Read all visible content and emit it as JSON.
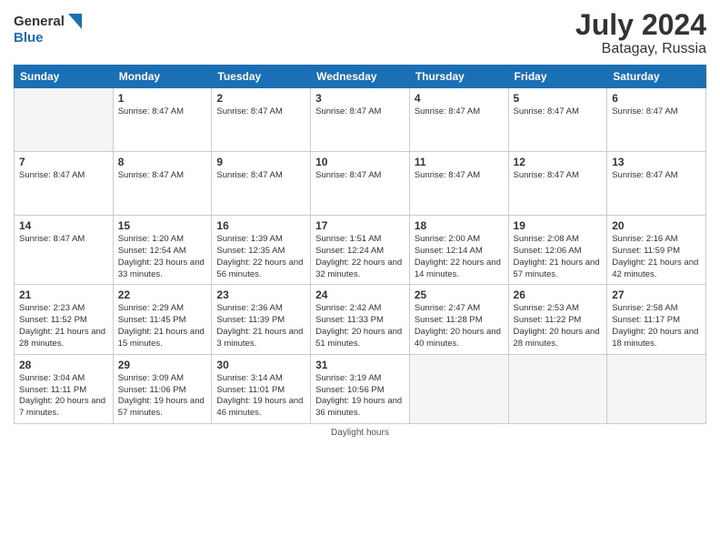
{
  "logo": {
    "line1": "General",
    "line2": "Blue"
  },
  "title": "July 2024",
  "location": "Batagay, Russia",
  "days_of_week": [
    "Sunday",
    "Monday",
    "Tuesday",
    "Wednesday",
    "Thursday",
    "Friday",
    "Saturday"
  ],
  "footer": "Daylight hours",
  "weeks": [
    [
      {
        "day": "",
        "info": ""
      },
      {
        "day": "1",
        "info": "Sunrise: 8:47 AM"
      },
      {
        "day": "2",
        "info": "Sunrise: 8:47 AM"
      },
      {
        "day": "3",
        "info": "Sunrise: 8:47 AM"
      },
      {
        "day": "4",
        "info": "Sunrise: 8:47 AM"
      },
      {
        "day": "5",
        "info": "Sunrise: 8:47 AM"
      },
      {
        "day": "6",
        "info": "Sunrise: 8:47 AM"
      }
    ],
    [
      {
        "day": "7",
        "info": "Sunrise: 8:47 AM"
      },
      {
        "day": "8",
        "info": "Sunrise: 8:47 AM"
      },
      {
        "day": "9",
        "info": "Sunrise: 8:47 AM"
      },
      {
        "day": "10",
        "info": "Sunrise: 8:47 AM"
      },
      {
        "day": "11",
        "info": "Sunrise: 8:47 AM"
      },
      {
        "day": "12",
        "info": "Sunrise: 8:47 AM"
      },
      {
        "day": "13",
        "info": "Sunrise: 8:47 AM"
      }
    ],
    [
      {
        "day": "14",
        "info": "Sunrise: 8:47 AM"
      },
      {
        "day": "15",
        "info": "Sunrise: 1:20 AM\nSunset: 12:54 AM\nDaylight: 23 hours and 33 minutes."
      },
      {
        "day": "16",
        "info": "Sunrise: 1:39 AM\nSunset: 12:35 AM\nDaylight: 22 hours and 56 minutes."
      },
      {
        "day": "17",
        "info": "Sunrise: 1:51 AM\nSunset: 12:24 AM\nDaylight: 22 hours and 32 minutes."
      },
      {
        "day": "18",
        "info": "Sunrise: 2:00 AM\nSunset: 12:14 AM\nDaylight: 22 hours and 14 minutes."
      },
      {
        "day": "19",
        "info": "Sunrise: 2:08 AM\nSunset: 12:06 AM\nDaylight: 21 hours and 57 minutes."
      },
      {
        "day": "20",
        "info": "Sunrise: 2:16 AM\nSunset: 11:59 PM\nDaylight: 21 hours and 42 minutes."
      }
    ],
    [
      {
        "day": "21",
        "info": "Sunrise: 2:23 AM\nSunset: 11:52 PM\nDaylight: 21 hours and 28 minutes."
      },
      {
        "day": "22",
        "info": "Sunrise: 2:29 AM\nSunset: 11:45 PM\nDaylight: 21 hours and 15 minutes."
      },
      {
        "day": "23",
        "info": "Sunrise: 2:36 AM\nSunset: 11:39 PM\nDaylight: 21 hours and 3 minutes."
      },
      {
        "day": "24",
        "info": "Sunrise: 2:42 AM\nSunset: 11:33 PM\nDaylight: 20 hours and 51 minutes."
      },
      {
        "day": "25",
        "info": "Sunrise: 2:47 AM\nSunset: 11:28 PM\nDaylight: 20 hours and 40 minutes."
      },
      {
        "day": "26",
        "info": "Sunrise: 2:53 AM\nSunset: 11:22 PM\nDaylight: 20 hours and 28 minutes."
      },
      {
        "day": "27",
        "info": "Sunrise: 2:58 AM\nSunset: 11:17 PM\nDaylight: 20 hours and 18 minutes."
      }
    ],
    [
      {
        "day": "28",
        "info": "Sunrise: 3:04 AM\nSunset: 11:11 PM\nDaylight: 20 hours and 7 minutes."
      },
      {
        "day": "29",
        "info": "Sunrise: 3:09 AM\nSunset: 11:06 PM\nDaylight: 19 hours and 57 minutes."
      },
      {
        "day": "30",
        "info": "Sunrise: 3:14 AM\nSunset: 11:01 PM\nDaylight: 19 hours and 46 minutes."
      },
      {
        "day": "31",
        "info": "Sunrise: 3:19 AM\nSunset: 10:56 PM\nDaylight: 19 hours and 36 minutes."
      },
      {
        "day": "",
        "info": ""
      },
      {
        "day": "",
        "info": ""
      },
      {
        "day": "",
        "info": ""
      }
    ]
  ]
}
